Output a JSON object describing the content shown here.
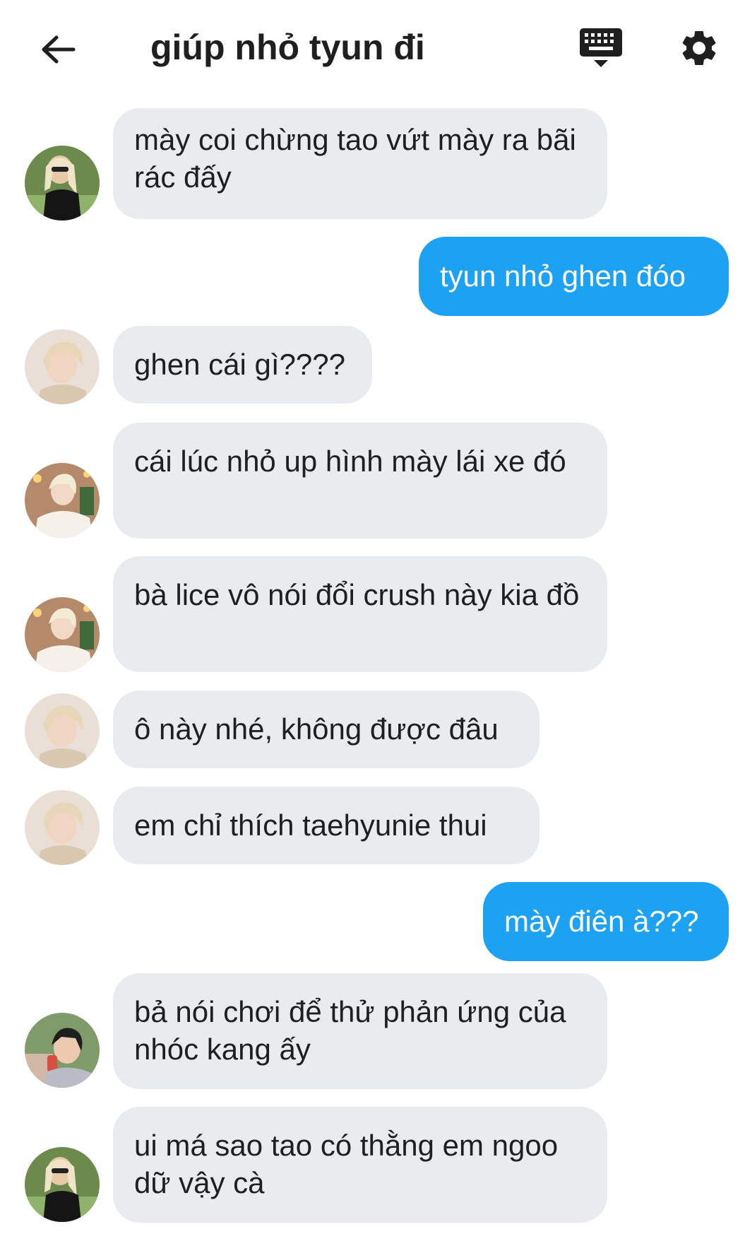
{
  "header": {
    "title": "giúp nhỏ tyun đi",
    "back_icon": "arrow-left-icon",
    "keyboard_icon": "keyboard-icon",
    "settings_icon": "gear-icon"
  },
  "colors": {
    "incoming_bubble": "#e9ecef",
    "outgoing_bubble": "#1da1f2",
    "text": "#1f1f1f"
  },
  "messages": [
    {
      "side": "in",
      "avatar": "avatar-girl",
      "text": "mày coi chừng tao vứt mày ra bãi rác đấy"
    },
    {
      "side": "out",
      "text": "tyun nhỏ ghen đóo"
    },
    {
      "side": "in",
      "avatar": "avatar-blonde-boy",
      "text": "ghen cái gì????"
    },
    {
      "side": "in",
      "avatar": "avatar-sweater-boy",
      "text": "cái lúc nhỏ up hình mày lái xe đó"
    },
    {
      "side": "in",
      "avatar": "avatar-sweater-boy",
      "text": "bà lice vô nói đổi crush này kia đồ"
    },
    {
      "side": "in",
      "avatar": "avatar-blonde-boy",
      "text": "ô này nhé, không được đâu"
    },
    {
      "side": "in",
      "avatar": "avatar-blonde-boy",
      "text": "em chỉ thích taehyunie thui"
    },
    {
      "side": "out",
      "text": "mày điên à???"
    },
    {
      "side": "in",
      "avatar": "avatar-darkhair-boy",
      "text": "bả nói chơi để thử phản ứng của nhóc kang ấy"
    },
    {
      "side": "in",
      "avatar": "avatar-girl",
      "text": "ui má sao tao có thằng em ngoo dữ vậy cà"
    }
  ]
}
